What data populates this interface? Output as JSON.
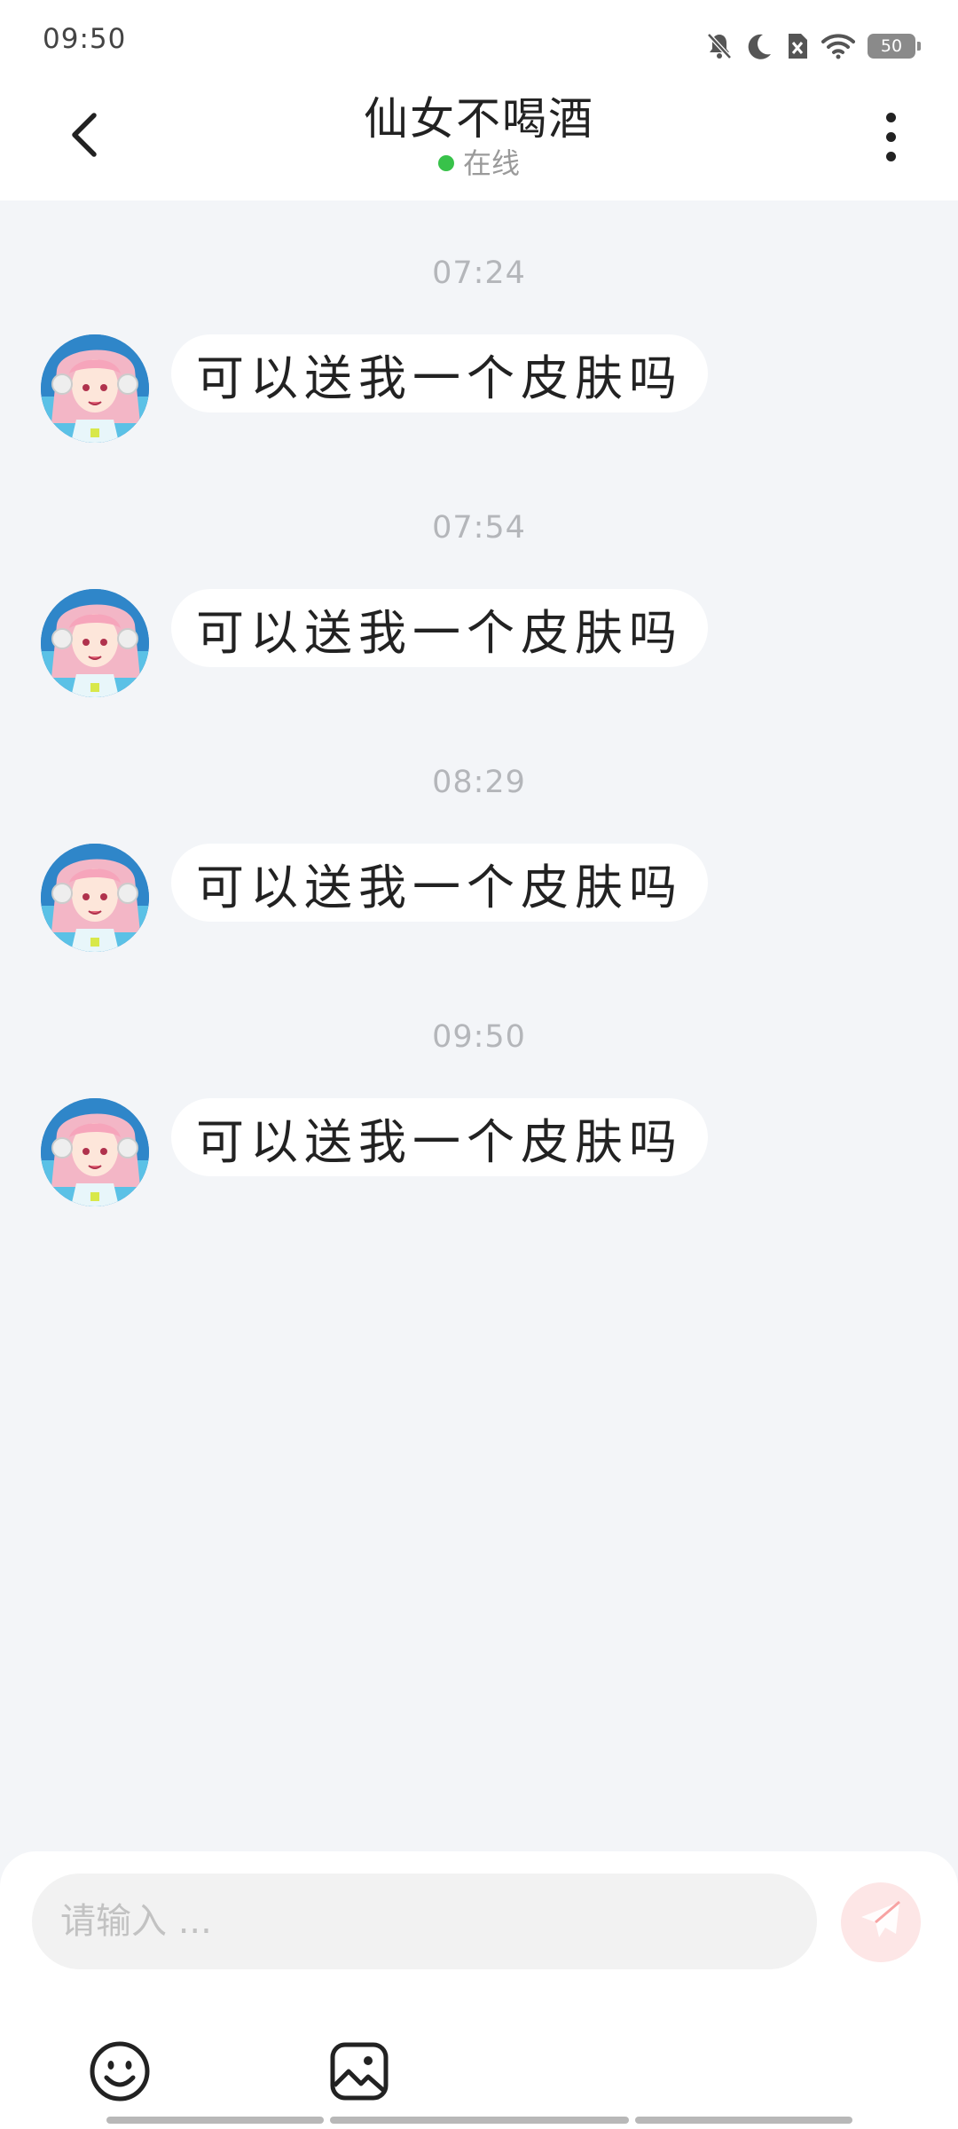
{
  "status_bar": {
    "time": "09:50",
    "battery": "50",
    "icons": [
      "bell-muted-icon",
      "moon-icon",
      "sim-off-icon",
      "wifi-icon",
      "battery-icon"
    ]
  },
  "header": {
    "title": "仙女不喝酒",
    "presence": "在线",
    "presence_color": "#38c24a",
    "back_icon": "chevron-left-icon",
    "more_icon": "more-vertical-icon"
  },
  "messages": [
    {
      "time": "07:24",
      "text": "可以送我一个皮肤吗"
    },
    {
      "time": "07:54",
      "text": "可以送我一个皮肤吗"
    },
    {
      "time": "08:29",
      "text": "可以送我一个皮肤吗"
    },
    {
      "time": "09:50",
      "text": "可以送我一个皮肤吗"
    }
  ],
  "composer": {
    "placeholder": "请输入 ...",
    "value": "",
    "send_icon": "paper-plane-icon",
    "send_color": "#f7a3a3",
    "tools": [
      "emoji-icon",
      "image-icon"
    ]
  }
}
